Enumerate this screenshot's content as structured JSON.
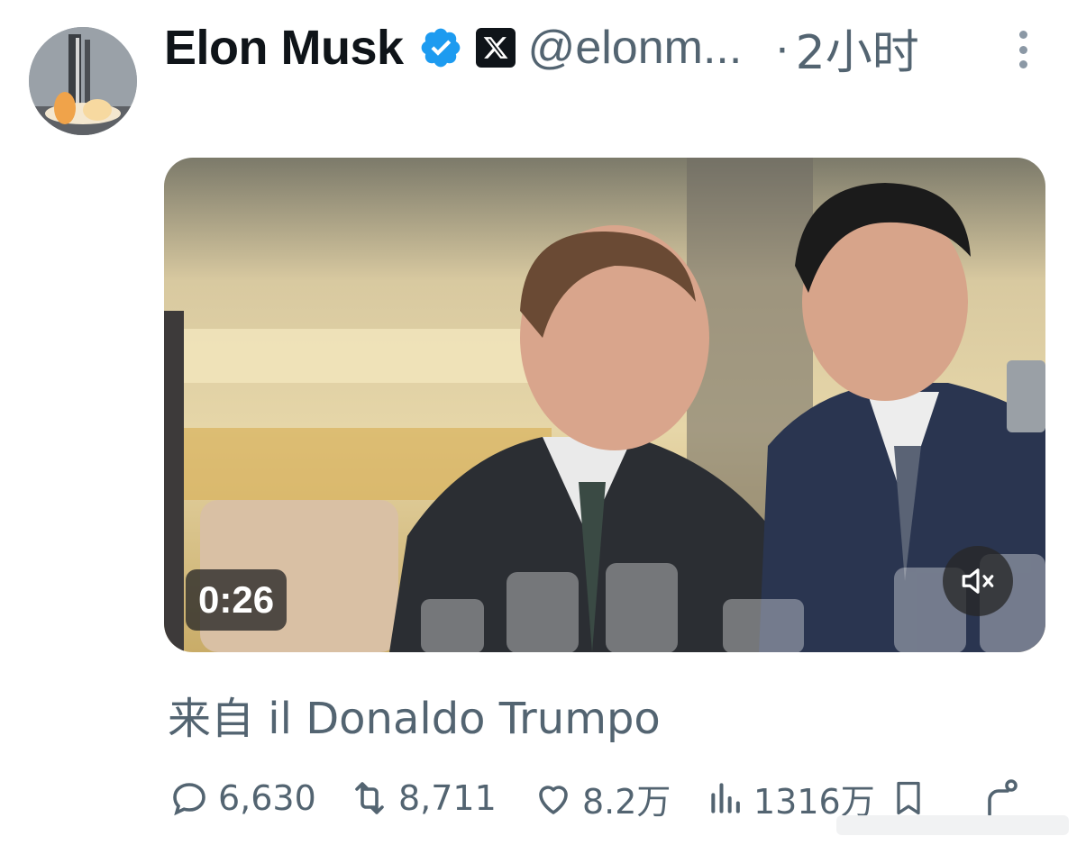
{
  "author": {
    "name": "Elon Musk",
    "handle": "@elonm...",
    "separator": "·",
    "time": "2小时"
  },
  "icons": {
    "verified": "verified-badge-icon",
    "x_logo": "x-logo-icon",
    "more": "more-options-icon",
    "mute": "volume-muted-icon",
    "reply": "reply-icon",
    "retweet": "retweet-icon",
    "like": "like-icon",
    "views": "views-icon",
    "bookmark": "bookmark-icon",
    "share": "share-icon"
  },
  "media": {
    "duration": "0:26"
  },
  "tweet": {
    "text": "来自 il Donaldo Trumpo"
  },
  "actions": {
    "replies": "6,630",
    "retweets": "8,711",
    "likes": "8.2万",
    "views": "1316万"
  },
  "colors": {
    "verified_blue": "#1d9bf0",
    "secondary_text": "#536471",
    "primary_text": "#0f1419"
  }
}
